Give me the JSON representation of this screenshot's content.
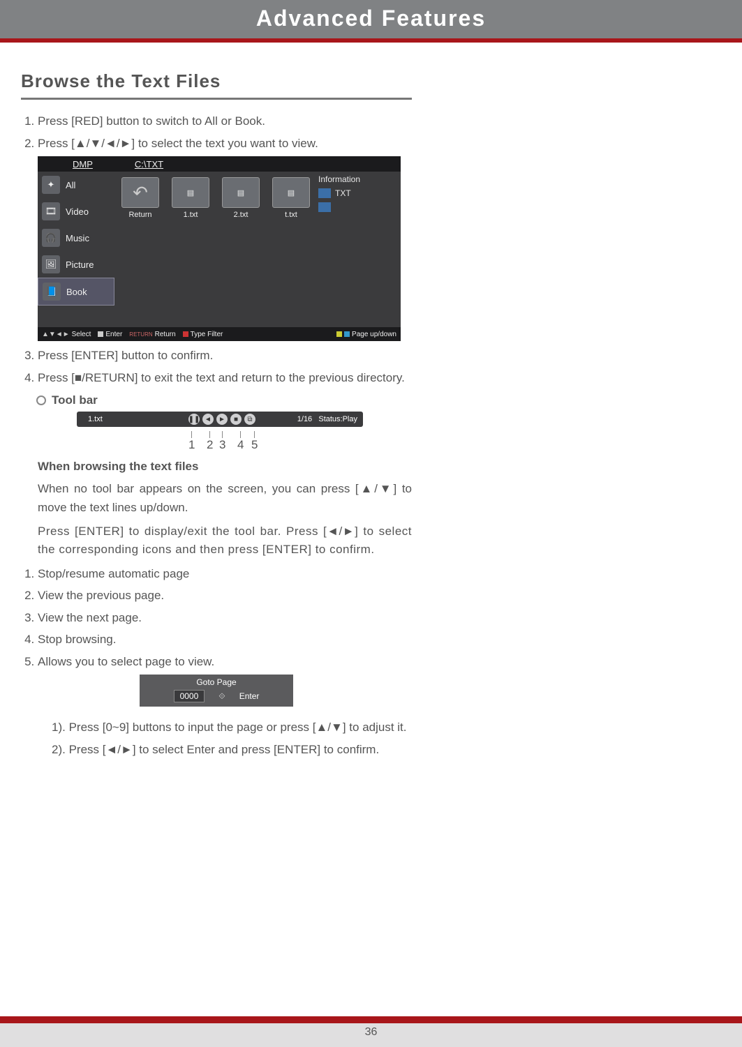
{
  "header": {
    "title": "Advanced Features"
  },
  "section_title": "Browse the Text Files",
  "steps": {
    "s1": "Press [RED] button to switch to All or Book.",
    "s2": "Press [▲/▼/◄/►] to select the text you want to view.",
    "s3": "Press [ENTER] button to confirm.",
    "s4": "Press [■/RETURN] to exit the text and return to the previous directory."
  },
  "toolbar_heading": "Tool bar",
  "browsing_heading": "When browsing the text files",
  "browsing_p1": "When no tool bar appears on the screen, you can press [▲/▼] to move the text lines up/down.",
  "browsing_p2": "Press [ENTER] to display/exit the tool bar. Press [◄/►] to select the corresponding icons and then press [ENTER] to confirm.",
  "icon_desc": {
    "i1": "Stop/resume automatic page",
    "i2": "View the previous page.",
    "i3": "View the next page.",
    "i4": "Stop browsing.",
    "i5": "Allows you to select page to view."
  },
  "goto": {
    "title": "Goto Page",
    "value": "0000",
    "enter": "Enter",
    "g1": "Press [0~9] buttons to input the page or press [▲/▼] to adjust it.",
    "g2": "Press [◄/►] to select Enter and press [ENTER] to confirm."
  },
  "browser": {
    "dmp": "DMP",
    "path": "C:\\TXT",
    "cats": {
      "all": "All",
      "video": "Video",
      "music": "Music",
      "picture": "Picture",
      "book": "Book"
    },
    "files": {
      "ret": "Return",
      "f1": "1.txt",
      "f2": "2.txt",
      "f3": "t.txt"
    },
    "info_label": "Information",
    "info_type": "TXT",
    "legend": {
      "select": "Select",
      "enter": "Enter",
      "return": "Return",
      "filter": "Type Filter",
      "page": "Page up/down"
    }
  },
  "toolbar": {
    "file": "1.txt",
    "page": "1/16",
    "status": "Status:Play",
    "labels": {
      "n1": "1",
      "n2": "2",
      "n3": "3",
      "n4": "4",
      "n5": "5"
    }
  },
  "page_number": "36"
}
